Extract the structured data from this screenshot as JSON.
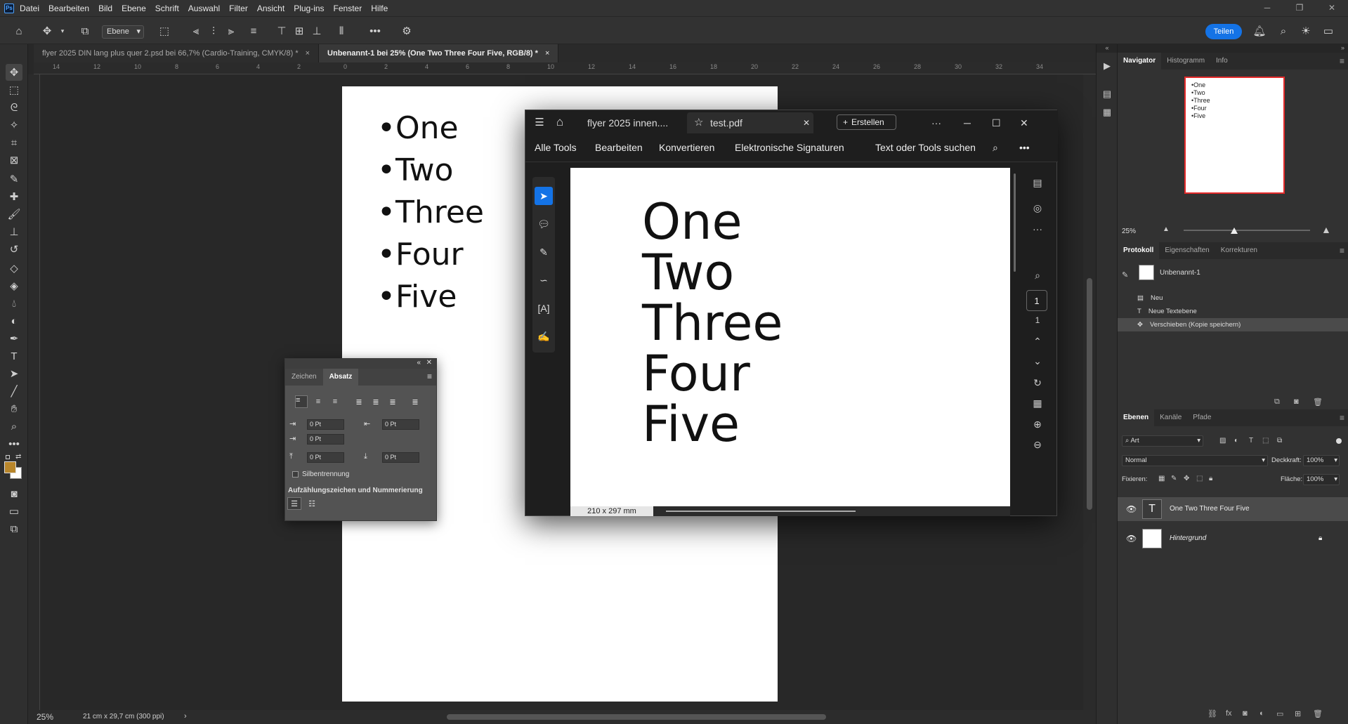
{
  "app": {
    "logo": "Ps"
  },
  "menubar": {
    "items": [
      "Datei",
      "Bearbeiten",
      "Bild",
      "Ebene",
      "Schrift",
      "Auswahl",
      "Filter",
      "Ansicht",
      "Plug-ins",
      "Fenster",
      "Hilfe"
    ]
  },
  "options": {
    "layer_select": "Ebene",
    "share_label": "Teilen"
  },
  "tabs": [
    {
      "label": "flyer 2025 DIN lang plus quer 2.psd bei 66,7% (Cardio-Training, CMYK/8) *",
      "close": "×"
    },
    {
      "label": "Unbenannt-1 bei 25% (One Two Three Four Five, RGB/8) *",
      "close": "×"
    }
  ],
  "ruler": {
    "top_ticks": [
      "14",
      "12",
      "10",
      "8",
      "6",
      "4",
      "2",
      "0",
      "2",
      "4",
      "6",
      "8",
      "10",
      "12",
      "14",
      "16",
      "18",
      "20",
      "22",
      "24",
      "26",
      "28",
      "30",
      "32",
      "34"
    ]
  },
  "document": {
    "lines": [
      "•One",
      "•Two",
      "•Three",
      "•Four",
      "•Five"
    ]
  },
  "paragraph_panel": {
    "tabs": [
      "Zeichen",
      "Absatz"
    ],
    "indent_left": "0 Pt",
    "indent_right": "0 Pt",
    "indent_first": "0 Pt",
    "space_before": "0 Pt",
    "space_after": "0 Pt",
    "hyphenation": "Silbentrennung",
    "bullets_title": "Aufzählungszeichen und Nummerierung"
  },
  "acrobat": {
    "tab1": "flyer 2025 innen....",
    "tab2": "test.pdf",
    "create": "Erstellen",
    "menu": [
      "Alle Tools",
      "Bearbeiten",
      "Konvertieren",
      "Elektronische Signaturen"
    ],
    "search": "Text oder Tools suchen",
    "pdf_lines": [
      "One",
      "Two",
      "Three",
      "Four",
      "Five"
    ],
    "page_size": "210 x 297 mm",
    "page_current": "1",
    "page_total": "1"
  },
  "status": {
    "zoom": "25%",
    "doc_info": "21 cm x 29,7 cm (300 ppi)"
  },
  "navigator": {
    "tabs": [
      "Navigator",
      "Histogramm",
      "Info"
    ],
    "thumb_lines": [
      "•One",
      "•Two",
      "•Three",
      "•Four",
      "•Five"
    ],
    "zoom": "25%"
  },
  "history": {
    "tabs": [
      "Protokoll",
      "Eigenschaften",
      "Korrekturen"
    ],
    "snapshot": "Unbenannt-1",
    "items": [
      "Neu",
      "Neue Textebene",
      "Verschieben (Kopie speichern)"
    ]
  },
  "layers": {
    "tabs": [
      "Ebenen",
      "Kanäle",
      "Pfade"
    ],
    "filter": "Art",
    "blend_mode": "Normal",
    "opacity_label": "Deckkraft:",
    "opacity": "100%",
    "lock_label": "Fixieren:",
    "fill_label": "Fläche:",
    "fill": "100%",
    "items": [
      {
        "name": "One Two Three Four Five",
        "thumb": "T"
      },
      {
        "name": "Hintergrund"
      }
    ]
  }
}
